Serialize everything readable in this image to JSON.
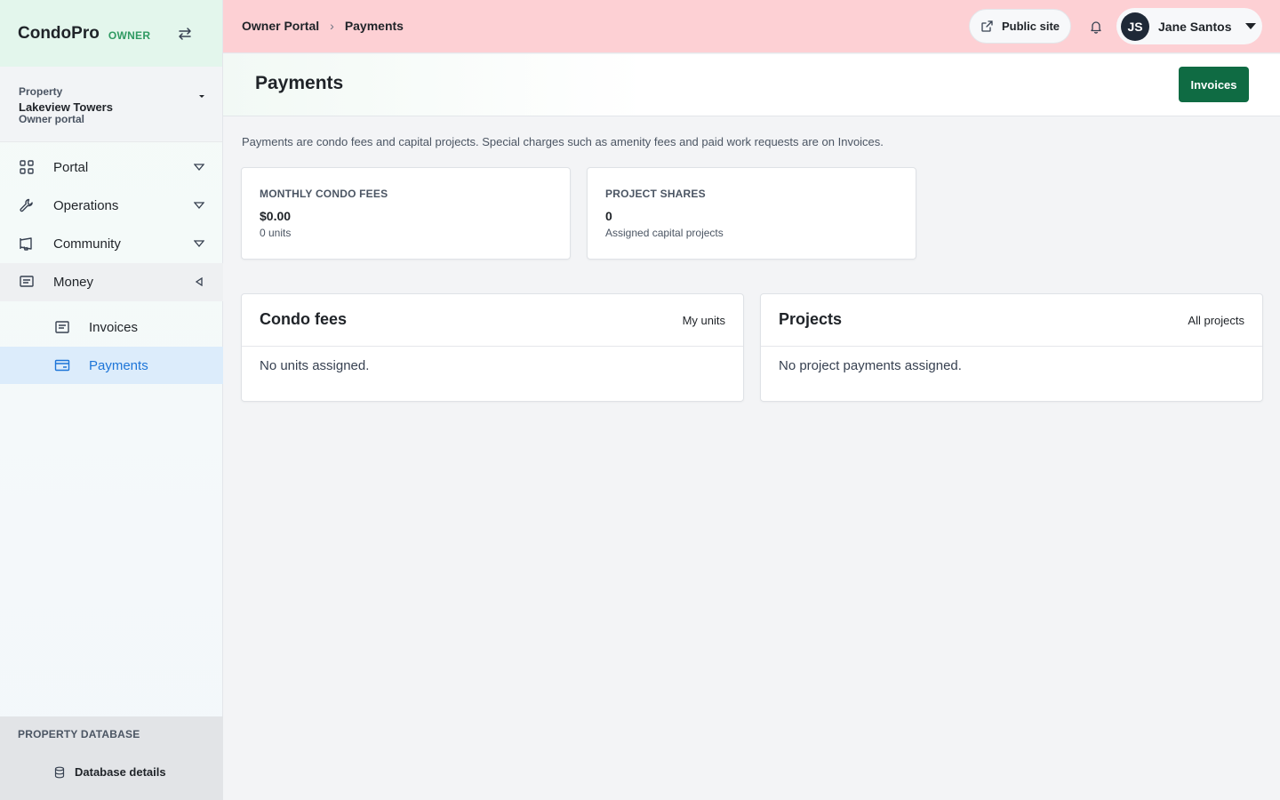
{
  "sidebar": {
    "brand": "CondoPro",
    "role": "OWNER",
    "property": {
      "label": "Property",
      "name": "Lakeview Towers",
      "sub": "Owner portal"
    },
    "nav": [
      {
        "label": "Portal",
        "icon": "grid-icon",
        "expanded": false
      },
      {
        "label": "Operations",
        "icon": "wrench-icon",
        "expanded": false
      },
      {
        "label": "Community",
        "icon": "megaphone-icon",
        "expanded": false
      },
      {
        "label": "Money",
        "icon": "receipt-icon",
        "expanded": true
      }
    ],
    "money_items": [
      {
        "label": "Invoices",
        "icon": "receipt-icon",
        "active": false
      },
      {
        "label": "Payments",
        "icon": "card-icon",
        "active": true
      }
    ],
    "db_section": {
      "title": "PROPERTY DATABASE",
      "item": "Database details"
    }
  },
  "header": {
    "breadcrumb": [
      "Owner Portal",
      "Payments"
    ],
    "public_site": "Public site",
    "user": {
      "initials": "JS",
      "name": "Jane Santos"
    }
  },
  "page": {
    "title": "Payments",
    "invoices_button": "Invoices",
    "intro": "Payments are condo fees and capital projects. Special charges such as amenity fees and paid work requests are on Invoices.",
    "stats": [
      {
        "label": "MONTHLY CONDO FEES",
        "value": "$0.00",
        "sub": "0 units"
      },
      {
        "label": "PROJECT SHARES",
        "value": "0",
        "sub": "Assigned capital projects"
      }
    ],
    "panels": [
      {
        "title": "Condo fees",
        "link": "My units",
        "empty": "No units assigned."
      },
      {
        "title": "Projects",
        "link": "All projects",
        "empty": "No project payments assigned."
      }
    ]
  },
  "colors": {
    "brand_accent": "#2f9a62",
    "primary_button": "#0f6b43",
    "header_bg": "#fdd0d4",
    "active_nav": "#1d75d8"
  }
}
